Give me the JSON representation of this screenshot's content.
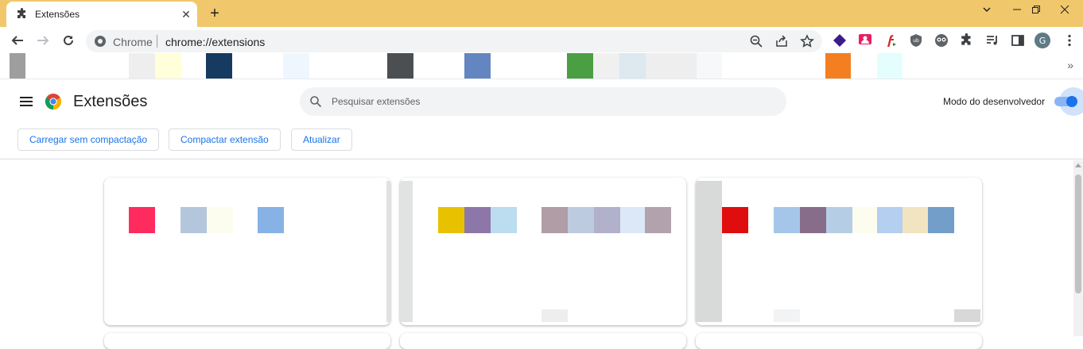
{
  "tab": {
    "title": "Extensões",
    "icon": "puzzle-icon"
  },
  "omnibox": {
    "site_label": "Chrome",
    "url": "chrome://extensions"
  },
  "header": {
    "title": "Extensões",
    "search_placeholder": "Pesquisar extensões",
    "developer_mode_label": "Modo do desenvolvedor",
    "developer_mode_on": true
  },
  "actions": {
    "load_unpacked": "Carregar sem compactação",
    "pack_extension": "Compactar extensão",
    "update": "Atualizar"
  },
  "bookmarks_overflow": "»",
  "colors": {
    "titlebar": "#f0c86b",
    "accent": "#1a73e8",
    "toggle_track": "#8ab4f8"
  }
}
